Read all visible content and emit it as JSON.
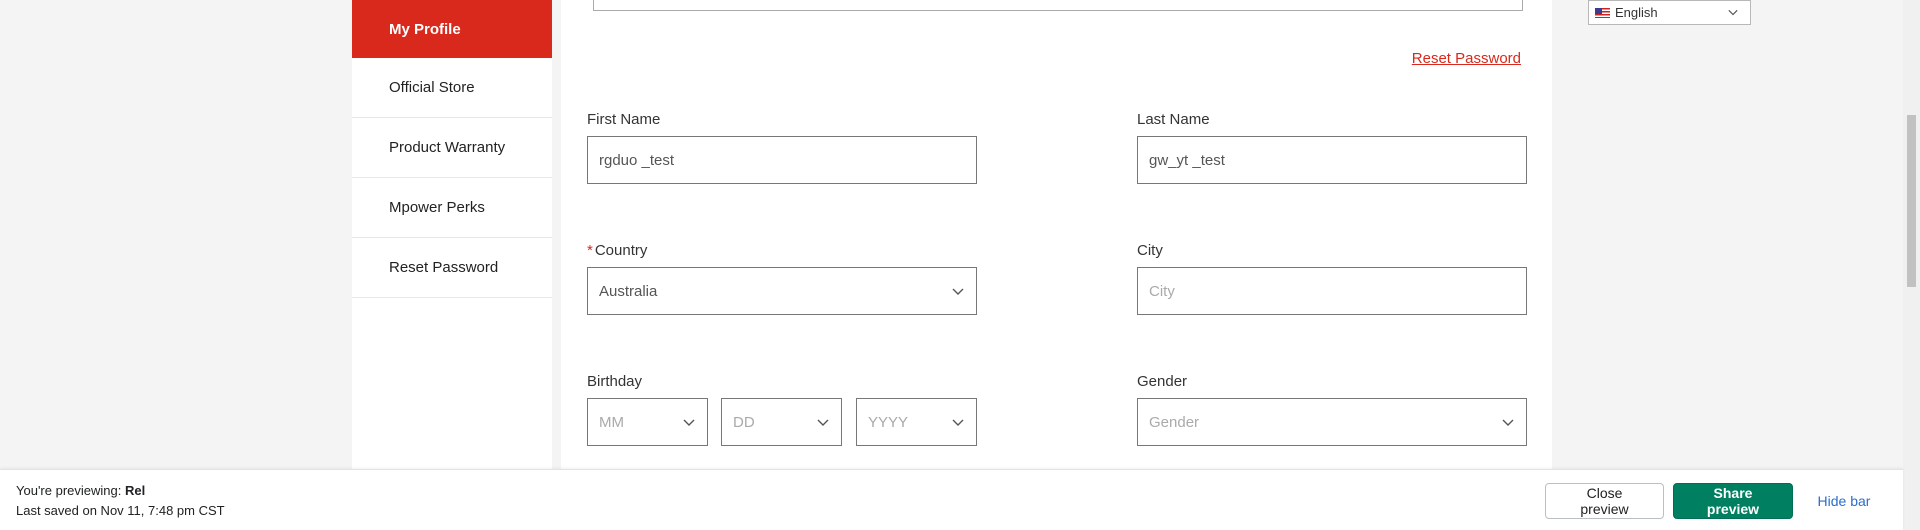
{
  "sidebar": {
    "items": [
      {
        "label": "My Profile"
      },
      {
        "label": "Official Store"
      },
      {
        "label": "Product Warranty"
      },
      {
        "label": "Mpower Perks"
      },
      {
        "label": "Reset Password"
      }
    ]
  },
  "profile": {
    "reset_password_link": "Reset Password",
    "first_name": {
      "label": "First Name",
      "value": "rgduo _test"
    },
    "last_name": {
      "label": "Last Name",
      "value": "gw_yt _test"
    },
    "country": {
      "label": "Country",
      "required_marker": "*",
      "value": "Australia"
    },
    "city": {
      "label": "City",
      "placeholder": "City"
    },
    "birthday": {
      "label": "Birthday",
      "month_placeholder": "MM",
      "day_placeholder": "DD",
      "year_placeholder": "YYYY"
    },
    "gender": {
      "label": "Gender",
      "placeholder": "Gender"
    }
  },
  "language": {
    "selected": "English",
    "flag_icon": "us-flag-icon"
  },
  "preview_bar": {
    "previewing_prefix": "You're previewing:",
    "theme_name": "Rel",
    "last_saved": "Last saved on Nov 11, 7:48 pm CST",
    "close_label": "Close preview",
    "share_label": "Share preview",
    "hide_label": "Hide bar"
  },
  "colors": {
    "accent_red": "#d9291c",
    "share_green": "#008060",
    "link_blue": "#2c6ecb"
  }
}
